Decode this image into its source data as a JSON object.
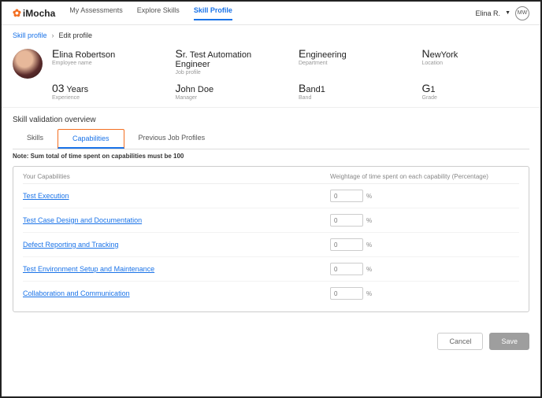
{
  "brand": "iMocha",
  "nav": {
    "assessments": "My Assessments",
    "explore": "Explore Skills",
    "profile": "Skill Profile"
  },
  "user": {
    "name": "Elina R.",
    "initials": "MW"
  },
  "breadcrumb": {
    "root": "Skill profile",
    "current": "Edit profile"
  },
  "profile": {
    "name": {
      "val": "Elina Robertson",
      "lbl": "Employee name"
    },
    "job": {
      "val": "Sr. Test Automation Engineer",
      "lbl": "Job profile"
    },
    "dept": {
      "val": "Engineering",
      "lbl": "Department"
    },
    "loc": {
      "val": "NewYork",
      "lbl": "Location"
    },
    "exp": {
      "val": "03 Years",
      "lbl": "Experience"
    },
    "mgr": {
      "val": "John Doe",
      "lbl": "Manager"
    },
    "band": {
      "val": "Band1",
      "lbl": "Band"
    },
    "grade": {
      "val": "G1",
      "lbl": "Grade"
    }
  },
  "section": "Skill validation overview",
  "subtabs": {
    "skills": "Skills",
    "capabilities": "Capabilities",
    "prev": "Previous Job Profiles"
  },
  "note": "Note: Sum total of time spent on capabilities must be 100",
  "cap_head": {
    "c1": "Your Capabilities",
    "c2": "Weightage of time spent on each capability (Percentage)"
  },
  "caps": {
    "r0": "Test Execution",
    "r1": "Test Case Design and Documentation",
    "r2": "Defect Reporting and Tracking",
    "r3": "Test Environment Setup and Maintenance",
    "r4": "Collaboration and Communication"
  },
  "placeholder": "0",
  "pct": "%",
  "buttons": {
    "cancel": "Cancel",
    "save": "Save"
  }
}
